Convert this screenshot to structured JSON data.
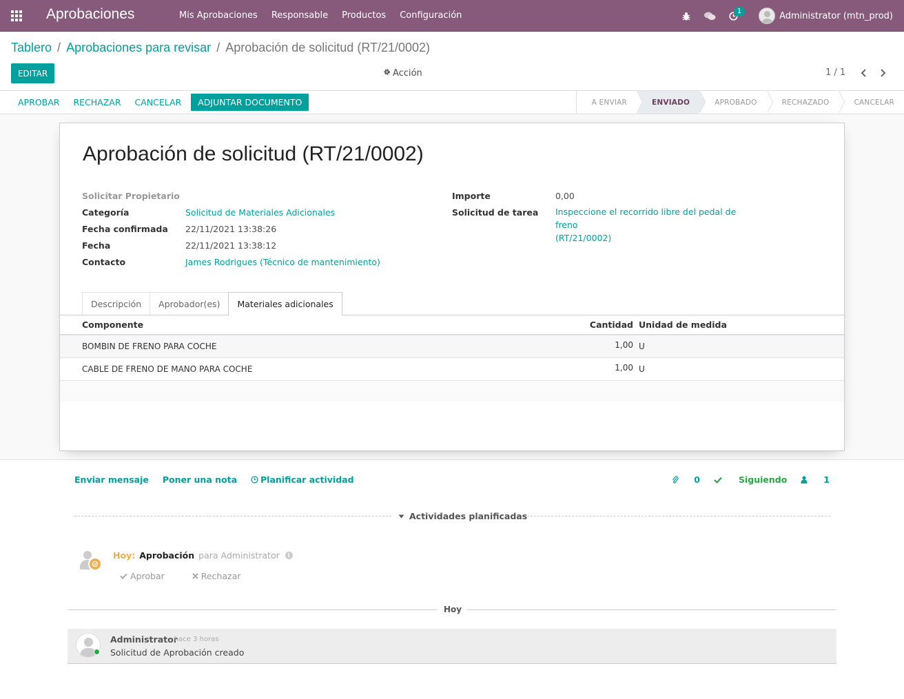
{
  "navbar": {
    "app_title": "Aprobaciones",
    "menu": [
      "Mis Aprobaciones",
      "Responsable",
      "Productos",
      "Configuración"
    ],
    "activity_count": "1",
    "user": "Administrator (mtn_prod)",
    "color": "#875a7b"
  },
  "breadcrumb": {
    "level1": "Tablero",
    "level2": "Aprobaciones para revisar",
    "current": "Aprobación de solicitud (RT/21/0002)"
  },
  "controls": {
    "edit": "EDITAR",
    "action": "Acción",
    "pager": "1 / 1"
  },
  "statusbar": {
    "buttons": {
      "approve": "APROBAR",
      "reject": "RECHAZAR",
      "cancel": "CANCELAR",
      "attach": "ADJUNTAR DOCUMENTO"
    },
    "stages": [
      "A ENVIAR",
      "ENVIADO",
      "APROBADO",
      "RECHAZADO",
      "CANCELAR"
    ],
    "current_stage": "ENVIADO"
  },
  "form": {
    "title": "Aprobación de solicitud (RT/21/0002)",
    "left": {
      "owner_label": "Solicitar Propietario",
      "category_label": "Categoría",
      "category_value": "Solicitud de Materiales Adicionales",
      "confirmed_label": "Fecha confirmada",
      "confirmed_value": "22/11/2021 13:38:26",
      "date_label": "Fecha",
      "date_value": "22/11/2021 13:38:12",
      "contact_label": "Contacto",
      "contact_value": "James Rodrigues (Técnico de mantenimiento)"
    },
    "right": {
      "amount_label": "Importe",
      "amount_value": "0,00",
      "task_label": "Solicitud de tarea",
      "task_value_line1": "Inspeccione el recorrido libre del pedal de freno",
      "task_value_line2": "(RT/21/0002)"
    },
    "tabs": [
      "Descripción",
      "Aprobador(es)",
      "Materiales adicionales"
    ],
    "active_tab": "Materiales adicionales",
    "table": {
      "headers": [
        "Componente",
        "Cantidad",
        "Unidad de medida"
      ],
      "rows": [
        [
          "BOMBIN DE FRENO PARA COCHE",
          "1,00",
          "U"
        ],
        [
          "CABLE DE FRENO DE MANO PARA COCHE",
          "1,00",
          "U"
        ]
      ]
    }
  },
  "chatter": {
    "send_message": "Enviar mensaje",
    "log_note": "Poner una nota",
    "schedule": "Planificar actividad",
    "attachments": "0",
    "following": "Siguiendo",
    "followers": "1",
    "planned_title": "Actividades planificadas",
    "activity": {
      "when": "Hoy:",
      "title": "Aprobación",
      "for": "para Administrator",
      "approve": "Aprobar",
      "reject": "Rechazar"
    },
    "today_label": "Hoy",
    "message": {
      "author": "Administrator",
      "date": "- hace 3 horas",
      "body": "Solicitud de Aprobación creado"
    }
  }
}
